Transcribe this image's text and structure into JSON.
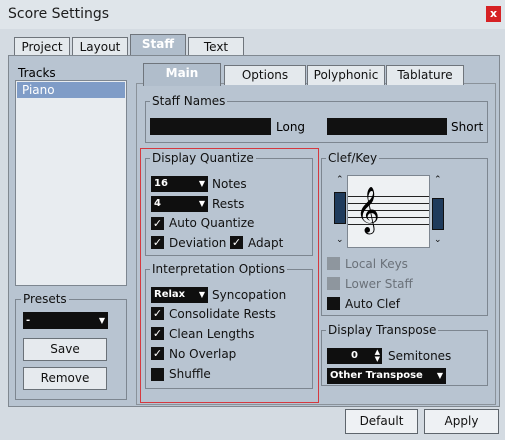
{
  "window": {
    "title": "Score Settings",
    "close_glyph": "x"
  },
  "top_tabs": [
    "Project",
    "Layout",
    "Staff",
    "Text"
  ],
  "sub_tabs": [
    "Main",
    "Options",
    "Polyphonic",
    "Tablature"
  ],
  "tracks": {
    "label": "Tracks",
    "items": [
      "Piano"
    ]
  },
  "presets": {
    "label": "Presets",
    "value": "-",
    "save_label": "Save",
    "remove_label": "Remove"
  },
  "staff_names": {
    "label": "Staff Names",
    "long_label": "Long",
    "short_label": "Short",
    "long_value": "",
    "short_value": ""
  },
  "display_quantize": {
    "label": "Display Quantize",
    "notes_value": "16",
    "notes_label": "Notes",
    "rests_value": "4",
    "rests_label": "Rests",
    "auto_quantize_label": "Auto Quantize",
    "auto_quantize_checked": true,
    "deviation_label": "Deviation",
    "deviation_checked": true,
    "adapt_label": "Adapt",
    "adapt_checked": true
  },
  "interpretation": {
    "label": "Interpretation Options",
    "syncopation_value": "Relax",
    "syncopation_label": "Syncopation",
    "consolidate_rests_label": "Consolidate Rests",
    "consolidate_rests_checked": true,
    "clean_lengths_label": "Clean Lengths",
    "clean_lengths_checked": true,
    "no_overlap_label": "No Overlap",
    "no_overlap_checked": true,
    "shuffle_label": "Shuffle",
    "shuffle_checked": false
  },
  "clef_key": {
    "label": "Clef/Key",
    "clef_glyph": "𝄞",
    "local_keys_label": "Local Keys",
    "local_keys_enabled": false,
    "lower_staff_label": "Lower Staff",
    "lower_staff_enabled": false,
    "auto_clef_label": "Auto Clef",
    "auto_clef_checked": false
  },
  "display_transpose": {
    "label": "Display Transpose",
    "semitones_value": "0",
    "semitones_label": "Semitones",
    "transpose_value": "Other Transpose"
  },
  "buttons": {
    "default_label": "Default",
    "apply_label": "Apply"
  },
  "colors": {
    "accent_tab": "#b0bdcb",
    "selection": "#7f9cc7",
    "highlight_box": "#d5393f",
    "close_button": "#d62124"
  }
}
